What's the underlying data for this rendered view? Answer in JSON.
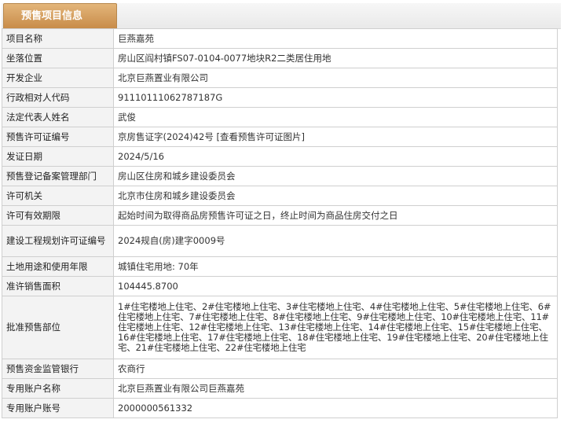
{
  "section_tab": "预售项目信息",
  "rows": [
    {
      "label": "项目名称",
      "value": "巨燕嘉苑"
    },
    {
      "label": "坐落位置",
      "value": "房山区阎村镇FS07-0104-0077地块R2二类居住用地"
    },
    {
      "label": "开发企业",
      "value": "北京巨燕置业有限公司"
    },
    {
      "label": "行政相对人代码",
      "value": "91110111062787187G"
    },
    {
      "label": "法定代表人姓名",
      "value": "武俊"
    },
    {
      "label": "预售许可证编号",
      "value": "京房售证字(2024)42号  [查看预售许可证图片]"
    },
    {
      "label": "发证日期",
      "value": "2024/5/16"
    },
    {
      "label": "预售登记备案管理部门",
      "value": "房山区住房和城乡建设委员会"
    },
    {
      "label": "许可机关",
      "value": "北京市住房和城乡建设委员会"
    },
    {
      "label": "许可有效期限",
      "value": "起始时间为取得商品房预售许可证之日，终止时间为商品住房交付之日"
    },
    {
      "label": "建设工程规划许可证编号",
      "value": "2024规自(房)建字0009号"
    },
    {
      "label": "土地用途和使用年限",
      "value": "城镇住宅用地: 70年"
    },
    {
      "label": "准许销售面积",
      "value": "104445.8700"
    },
    {
      "label": "批准预售部位",
      "value": "1#住宅楼地上住宅、2#住宅楼地上住宅、3#住宅楼地上住宅、4#住宅楼地上住宅、5#住宅楼地上住宅、6#住宅楼地上住宅、7#住宅楼地上住宅、8#住宅楼地上住宅、9#住宅楼地上住宅、10#住宅楼地上住宅、11#住宅楼地上住宅、12#住宅楼地上住宅、13#住宅楼地上住宅、14#住宅楼地上住宅、15#住宅楼地上住宅、16#住宅楼地上住宅、17#住宅楼地上住宅、18#住宅楼地上住宅、19#住宅楼地上住宅、20#住宅楼地上住宅、21#住宅楼地上住宅、22#住宅楼地上住宅"
    },
    {
      "label": "预售资金监管银行",
      "value": "农商行"
    },
    {
      "label": "专用账户名称",
      "value": "北京巨燕置业有限公司巨燕嘉苑"
    },
    {
      "label": "专用账户账号",
      "value": "2000000561332"
    }
  ]
}
